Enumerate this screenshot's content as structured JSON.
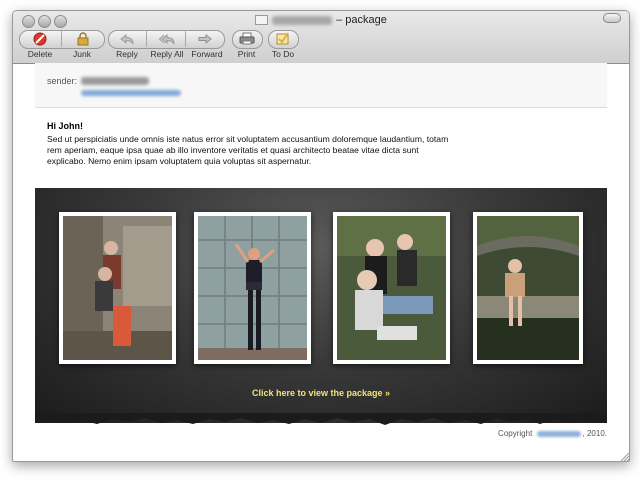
{
  "window": {
    "title": "– package"
  },
  "toolbar": {
    "buttons": [
      {
        "label": "Delete",
        "icon": "delete-icon"
      },
      {
        "label": "Junk",
        "icon": "junk-icon"
      },
      {
        "label": "Reply",
        "icon": "reply-icon"
      },
      {
        "label": "Reply All",
        "icon": "reply-all-icon"
      },
      {
        "label": "Forward",
        "icon": "forward-icon"
      },
      {
        "label": "Print",
        "icon": "print-icon"
      },
      {
        "label": "To Do",
        "icon": "checkmark-icon"
      }
    ]
  },
  "message": {
    "sender_label": "sender:",
    "greeting": "Hi John!",
    "body": "Sed ut perspiciatis unde omnis iste natus error sit voluptatem accusantium doloremque laudantium, totam rem aperiam, eaque ipsa quae ab illo inventore veritatis et quasi architecto beatae vitae dicta sunt explicabo. Nemo enim ipsam voluptatem quia voluptas sit aspernatur.",
    "cta": "Click here to view the package »",
    "footer_prefix": "Copyright",
    "footer_suffix": ", 2010."
  },
  "colors": {
    "cta": "#f3e27a",
    "gallery_bg": "#2c2c2c",
    "delete_red": "#d83a2e",
    "todo_yellow": "#e3b12b"
  }
}
